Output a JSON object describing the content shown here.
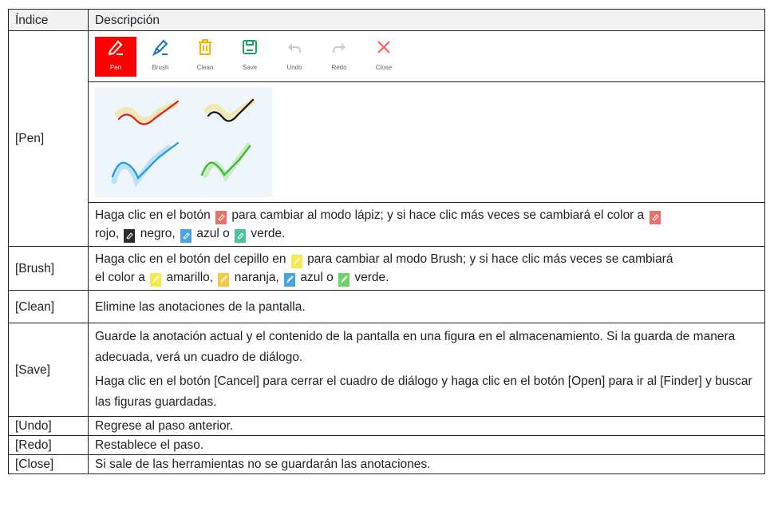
{
  "header": {
    "col_index": "Índice",
    "col_description": "Descripción"
  },
  "toolbar": {
    "tools": [
      {
        "label": "Pen",
        "icon": "pen-icon",
        "color": "#ff0000"
      },
      {
        "label": "Brush",
        "icon": "brush-icon",
        "color": "#1a73c8"
      },
      {
        "label": "Clean",
        "icon": "trash-icon",
        "color": "#f2b400"
      },
      {
        "label": "Save",
        "icon": "save-icon",
        "color": "#18a05a"
      },
      {
        "label": "Undo",
        "icon": "undo-icon",
        "color": "#c8cdd4"
      },
      {
        "label": "Redo",
        "icon": "redo-icon",
        "color": "#c8cdd4"
      },
      {
        "label": "Close",
        "icon": "close-icon",
        "color": "#ff5a5a"
      }
    ]
  },
  "rows": {
    "pen": {
      "index": "[Pen]",
      "desc_a": "Haga clic en el botón",
      "desc_b": "para cambiar al modo lápiz; y si hace clic más veces se cambiará el color a",
      "desc_c": "rojo,",
      "desc_d": "negro,",
      "desc_e": "azul o",
      "desc_f": "verde.",
      "mini_label": "Pen",
      "colors": {
        "red": "#e8716a",
        "black": "#2b2b2b",
        "blue": "#4aa3e0",
        "green": "#4bc49a"
      }
    },
    "brush": {
      "index": "[Brush]",
      "desc_a": "Haga clic en el botón del cepillo en",
      "desc_b": "para cambiar al modo Brush; y si hace clic más veces se cambiará",
      "desc_c": "el color a",
      "desc_d": "amarillo,",
      "desc_e": "naranja,",
      "desc_f": "azul o",
      "desc_g": "verde.",
      "mini_label": "Brush",
      "colors": {
        "yellow": "#f6e94a",
        "orange": "#f5c842",
        "blue": "#4aa3e0",
        "green": "#6bd36a"
      }
    },
    "clean": {
      "index": "[Clean]",
      "desc": "Elimine las anotaciones de la pantalla."
    },
    "save": {
      "index": "[Save]",
      "desc_1": "Guarde la anotación actual y el contenido de la pantalla en una figura en el almacenamiento. Si la guarda de manera adecuada, verá un cuadro de diálogo.",
      "desc_2": "Haga clic en el botón [Cancel] para cerrar el cuadro de diálogo y haga clic en el botón [Open] para ir al [Finder] y buscar las figuras guardadas."
    },
    "undo": {
      "index": "[Undo]",
      "desc": "Regrese al paso anterior."
    },
    "redo": {
      "index": "[Redo]",
      "desc": "Restablece el paso."
    },
    "close": {
      "index": "[Close]",
      "desc": "Si sale de las herramientas no se guardarán las anotaciones."
    }
  }
}
